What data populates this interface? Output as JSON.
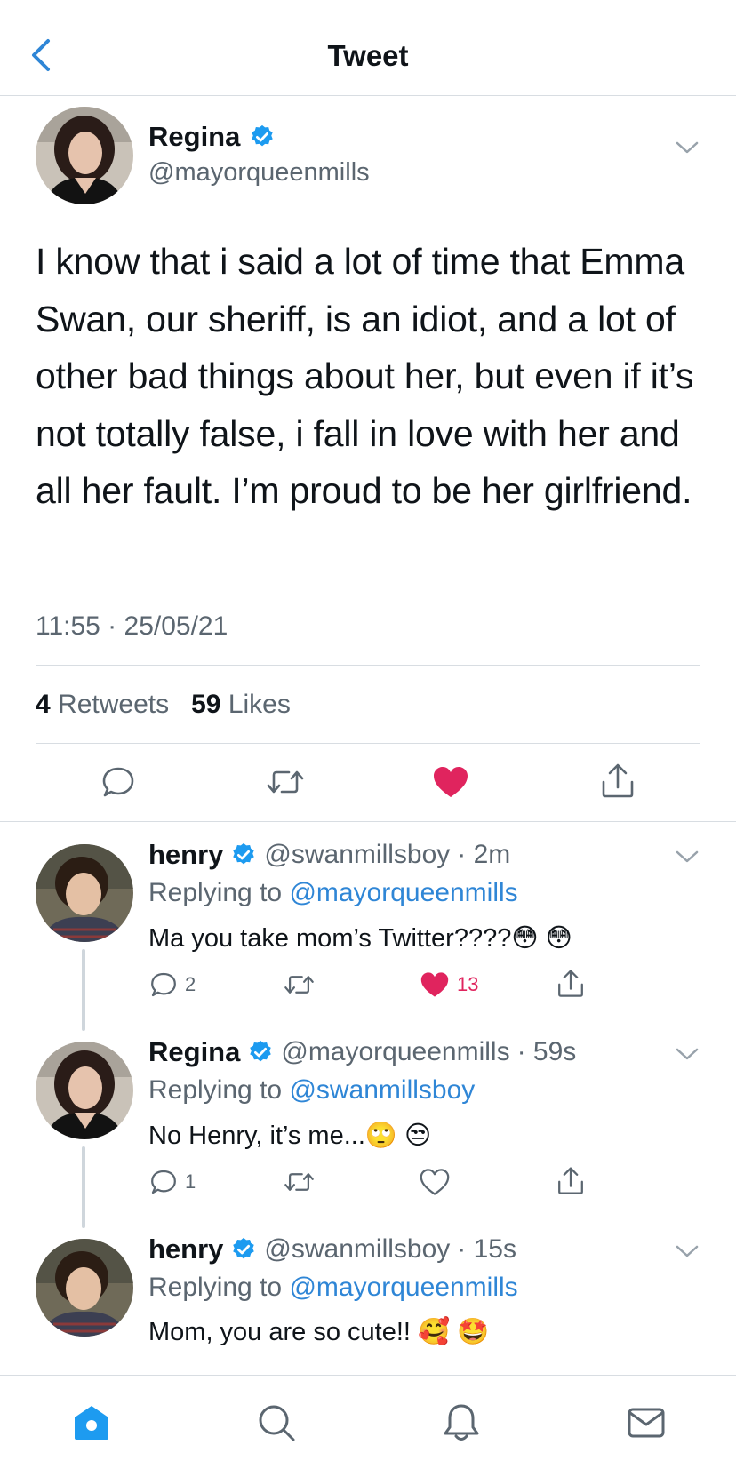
{
  "header": {
    "title": "Tweet"
  },
  "main_tweet": {
    "name": "Regina",
    "handle": "@mayorqueenmills",
    "text": "I know that i said a lot of time that Emma Swan, our sheriff, is an idiot, and a lot of other bad things about her, but even if it’s not totally false, i fall in love with her and all her fault. I’m proud to be her girlfriend.",
    "timestamp": "11:55 · 25/05/21",
    "retweets_count": "4",
    "retweets_label": "Retweets",
    "likes_count": "59",
    "likes_label": "Likes"
  },
  "replies": [
    {
      "name": "henry",
      "handle": "@swanmillsboy",
      "time": "· 2m",
      "replying_label": "Replying to",
      "replying_to": "@mayorqueenmills",
      "text": "Ma you take mom’s Twitter????😳 😳",
      "reply_count": "2",
      "retweet_count": "",
      "like_count": "13",
      "liked": true
    },
    {
      "name": "Regina",
      "handle": "@mayorqueenmills",
      "time": "· 59s",
      "replying_label": "Replying to",
      "replying_to": "@swanmillsboy",
      "text": "No Henry, it’s me...🙄 😒",
      "reply_count": "1",
      "retweet_count": "",
      "like_count": "",
      "liked": false
    },
    {
      "name": "henry",
      "handle": "@swanmillsboy",
      "time": "· 15s",
      "replying_label": "Replying to",
      "replying_to": "@mayorqueenmills",
      "text": "Mom, you are so cute!! 🥰 🤩"
    }
  ],
  "icons": {
    "back": "chevron-left-icon",
    "verified": "verified-badge-icon",
    "reply": "comment-icon",
    "retweet": "retweet-icon",
    "like": "heart-icon",
    "share": "share-icon",
    "home": "home-icon",
    "search": "search-icon",
    "notifications": "bell-icon",
    "messages": "mail-icon"
  },
  "colors": {
    "accent": "#1d9bf0",
    "like": "#e0245e",
    "muted": "#5b6670",
    "link": "#2f86d6"
  }
}
